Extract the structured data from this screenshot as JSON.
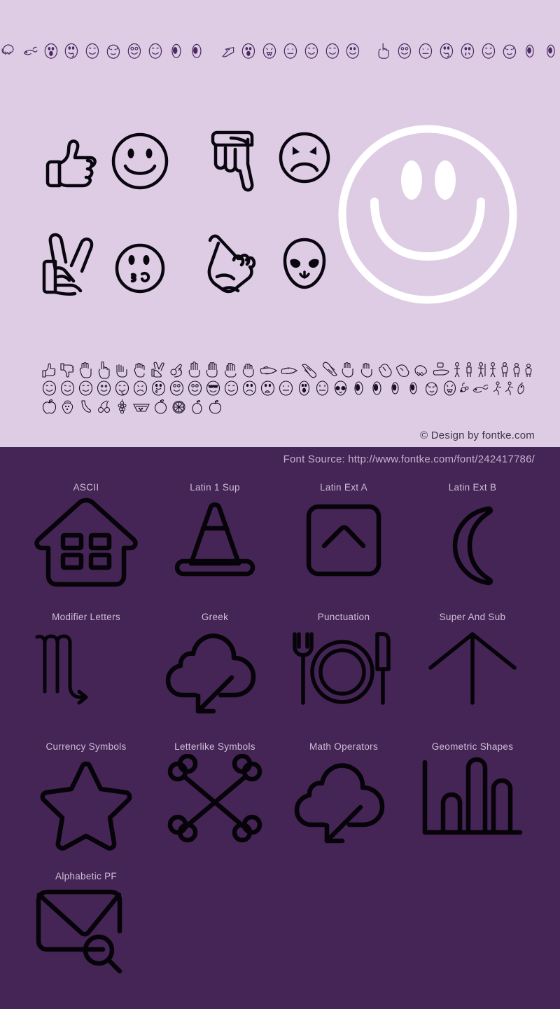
{
  "page": {
    "kind": "font-specimen",
    "light_bg": "#ddcce4",
    "dark_bg": "#452456",
    "title_ink": "#4b2a63",
    "glyph_ink": "#1b1020",
    "smiley_color": "#ffffff"
  },
  "header": {
    "note": "Title is typeset in the specimen dingbat font itself, so it renders as picture glyphs rather than readable latin text",
    "title_glyphs": [
      "handshake",
      "whale",
      "face-open-mouth",
      "face-tongue-out",
      "face-smile",
      "cat-face",
      "face-grin-eyes",
      "face-smile-2",
      "eye",
      "eye"
    ],
    "title_glyphs_2": [
      "hand-point-left",
      "face-open-mouth",
      "face-fangs",
      "face-neutral",
      "face-smile",
      "face-smile-2",
      "face-smile-3"
    ],
    "title_glyphs_3": [
      "hand-point-up",
      "face-smile",
      "face-neutral",
      "face-tongue-out",
      "face-kiss",
      "face-smile-2",
      "cat-face",
      "eye",
      "eye"
    ]
  },
  "showcase": {
    "pairs": [
      {
        "hand": "thumbs-up-hand",
        "face": "smiley-face"
      },
      {
        "hand": "hand-point-down",
        "face": "angry-face"
      },
      {
        "hand": "victory-peace-hand",
        "face": "kissing-face"
      },
      {
        "hand": "hand-point-up-index",
        "face": "alien-face"
      }
    ],
    "feature_glyph": "big-smiley-face"
  },
  "charmap": {
    "rows": [
      {
        "name": "hands-and-people",
        "glyphs": [
          "thumbs-up",
          "thumbs-down",
          "fist-up",
          "index-up",
          "hand-claw",
          "hand-grab",
          "victory",
          "ok-hand",
          "three-fingers",
          "open-palm",
          "raised-hand",
          "hand-spread",
          "point-right",
          "point-right-2",
          "point-down-right",
          "point-up-left",
          "two-hands",
          "hands-apart",
          "hand-wave",
          "hand-flat",
          "handshake",
          "hand-offer",
          "person",
          "person-2",
          "person-3",
          "person-4",
          "person-5",
          "person-6",
          "person-7"
        ]
      },
      {
        "name": "faces",
        "glyphs": [
          "smile",
          "smile-wink",
          "smile-2",
          "smile-3",
          "smile-tongue",
          "frown",
          "face-tear",
          "face-grin",
          "face-grin-2",
          "face-sunglasses",
          "smile-4",
          "frown-2",
          "face-surprise",
          "face-neutral",
          "face-open-mouth",
          "face-flat",
          "alien",
          "eye",
          "eye-2",
          "eye-3",
          "eye-4",
          "cat-face",
          "face-fangs",
          "bee",
          "whale",
          "runner",
          "runner-2",
          "bird"
        ]
      },
      {
        "name": "fruit",
        "glyphs": [
          "apple",
          "strawberry",
          "banana",
          "cherries",
          "grapes",
          "watermelon-slice",
          "orange-whole",
          "citrus-slice",
          "lemon",
          "peach"
        ]
      }
    ]
  },
  "credits": {
    "copyright": "© Design by fontke.com",
    "font_source": "Font Source: http://www.fontke.com/font/242417786/"
  },
  "unicode_blocks": {
    "rows": [
      [
        {
          "label": "ASCII",
          "glyph": "house"
        },
        {
          "label": "Latin 1 Sup",
          "glyph": "traffic-cone"
        },
        {
          "label": "Latin Ext A",
          "glyph": "chevron-up-square"
        },
        {
          "label": "Latin Ext B",
          "glyph": "crescent-moon"
        }
      ],
      [
        {
          "label": "Modifier Letters",
          "glyph": "scorpio-symbol"
        },
        {
          "label": "Greek",
          "glyph": "cloud-download"
        },
        {
          "label": "Punctuation",
          "glyph": "cutlery-plate"
        },
        {
          "label": "Super And Sub",
          "glyph": "arrow-up"
        }
      ],
      [
        {
          "label": "Currency Symbols",
          "glyph": "star"
        },
        {
          "label": "Letterlike Symbols",
          "glyph": "crossbones"
        },
        {
          "label": "Math Operators",
          "glyph": "cloud-download-2"
        },
        {
          "label": "Geometric Shapes",
          "glyph": "bar-chart"
        }
      ],
      [
        {
          "label": "Alphabetic PF",
          "glyph": "mail-search"
        }
      ]
    ]
  }
}
